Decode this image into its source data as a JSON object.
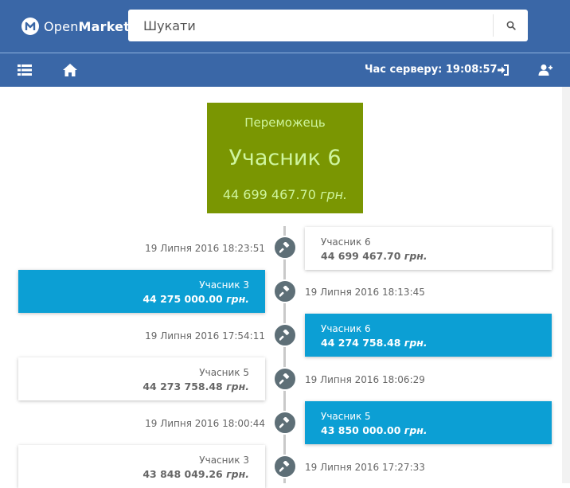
{
  "header": {
    "logo_prefix": "Open",
    "logo_bold": "Market",
    "search_placeholder": "Шукати"
  },
  "navbar": {
    "server_time_label": "Час серверу: 19:08:57"
  },
  "winner": {
    "label": "Переможець",
    "name": "Учасник 6",
    "amount": "44 699 467.70",
    "currency": "грн."
  },
  "bids": [
    {
      "name": "Учасник 6",
      "amount": "44 699 467.70",
      "currency": "грн.",
      "date": "19 Липня 2016 18:23:51"
    },
    {
      "name": "Учасник 3",
      "amount": "44 275 000.00",
      "currency": "грн.",
      "date": "19 Липня 2016 18:13:45"
    },
    {
      "name": "Учасник 6",
      "amount": "44 274 758.48",
      "currency": "грн.",
      "date": "19 Липня 2016 17:54:11"
    },
    {
      "name": "Учасник 5",
      "amount": "44 273 758.48",
      "currency": "грн.",
      "date": "19 Липня 2016 18:06:29"
    },
    {
      "name": "Учасник 5",
      "amount": "43 850 000.00",
      "currency": "грн.",
      "date": "19 Липня 2016 18:00:44"
    },
    {
      "name": "Учасник 3",
      "amount": "43 848 049.26",
      "currency": "грн.",
      "date": "19 Липня 2016 17:27:33"
    }
  ],
  "colors": {
    "header_bg": "#3a67a7",
    "winner_bg": "#7a9602",
    "bid_highlight": "#0c9fd4",
    "marker": "#5e6f77"
  }
}
